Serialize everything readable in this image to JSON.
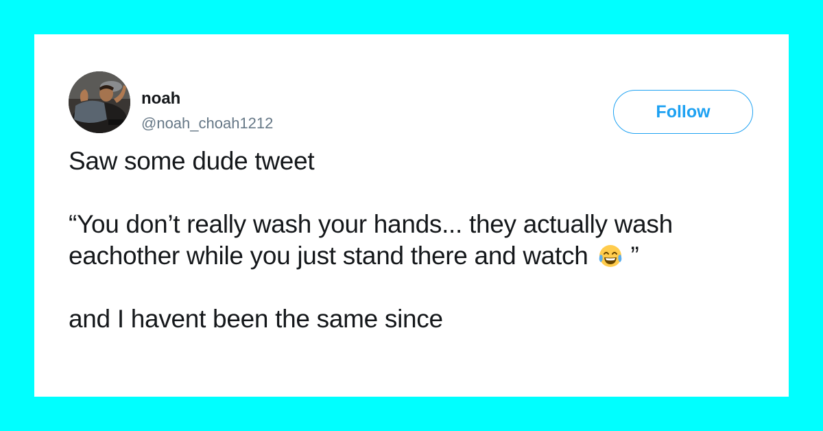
{
  "tweet": {
    "author": {
      "display_name": "noah",
      "handle": "@noah_choah1212"
    },
    "follow_label": "Follow",
    "text": {
      "line1": "Saw some dude tweet",
      "quote_line1": "“You don’t really wash your hands... they actually wash",
      "quote_line2_before_emoji": "eachother while you just stand there and watch",
      "quote_line2_after_emoji": "”",
      "closing": "and I havent been the same since"
    },
    "emoji": "face-with-tears-of-joy-icon"
  },
  "colors": {
    "background": "#00ffff",
    "card": "#ffffff",
    "accent": "#1da1f2",
    "text": "#14171a",
    "secondary_text": "#657786"
  }
}
